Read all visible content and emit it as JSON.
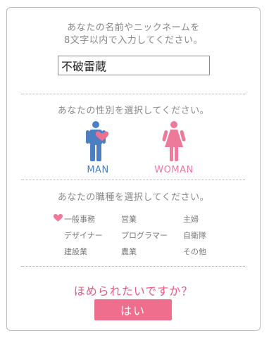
{
  "name_section": {
    "prompt_line1": "あなたの名前やニックネームを",
    "prompt_line2": "8文字以内で入力してください。",
    "input_value": "不破雷蔵"
  },
  "gender_section": {
    "prompt": "あなたの性別を選択してください。",
    "male_label": "MAN",
    "female_label": "WOMAN",
    "selected": "MAN"
  },
  "job_section": {
    "prompt": "あなたの職種を選択してください。",
    "jobs": [
      "一般事務",
      "営業",
      "主婦",
      "デザイナー",
      "プログラマー",
      "自衛隊",
      "建設業",
      "農業",
      "その他"
    ],
    "selected": "一般事務"
  },
  "confirm": {
    "question": "ほめられたいですか？",
    "yes_label": "はい"
  },
  "colors": {
    "male": "#4b7fc2",
    "female": "#ee7a9a",
    "accent": "#ea5a80",
    "button": "#ef6e8e"
  }
}
